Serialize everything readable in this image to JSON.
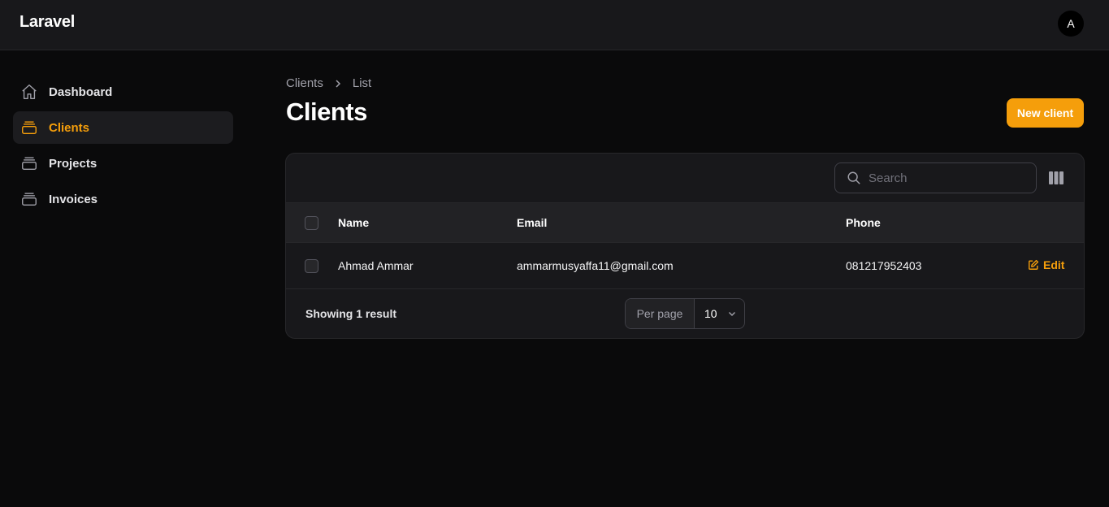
{
  "app": {
    "brand": "Laravel",
    "avatar_initial": "A"
  },
  "sidebar": {
    "items": [
      {
        "label": "Dashboard",
        "icon": "home-icon",
        "active": false
      },
      {
        "label": "Clients",
        "icon": "stack-icon",
        "active": true
      },
      {
        "label": "Projects",
        "icon": "stack-icon",
        "active": false
      },
      {
        "label": "Invoices",
        "icon": "stack-icon",
        "active": false
      }
    ]
  },
  "breadcrumb": {
    "items": [
      "Clients",
      "List"
    ]
  },
  "page": {
    "title": "Clients",
    "new_button": "New client"
  },
  "table": {
    "search_placeholder": "Search",
    "columns": [
      "Name",
      "Email",
      "Phone"
    ],
    "rows": [
      {
        "name": "Ahmad Ammar",
        "email": "ammarmusyaffa11@gmail.com",
        "phone": "081217952403",
        "action": "Edit"
      }
    ],
    "footer": {
      "showing": "Showing 1 result",
      "per_page_label": "Per page",
      "per_page_value": "10"
    }
  },
  "colors": {
    "accent": "#f59e0b",
    "background": "#0a0a0b",
    "surface": "#18181b"
  }
}
